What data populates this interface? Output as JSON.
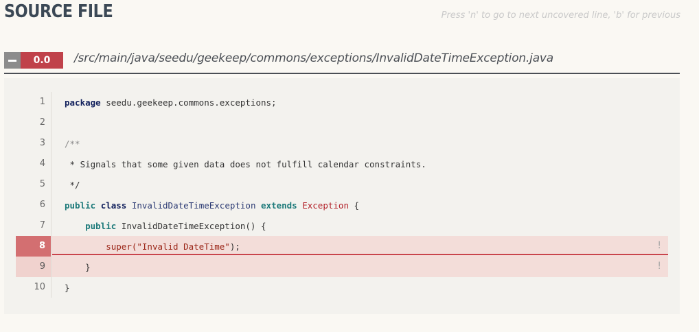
{
  "header": {
    "title": "SOURCE FILE",
    "hint": "Press 'n' to go to next uncovered line, 'b' for previous"
  },
  "file": {
    "coverage": "0.0",
    "path": "/src/main/java/seedu/geekeep/commons/exceptions/InvalidDateTimeException.java"
  },
  "lines": [
    {
      "n": "1"
    },
    {
      "n": "2"
    },
    {
      "n": "3"
    },
    {
      "n": "4"
    },
    {
      "n": "5"
    },
    {
      "n": "6"
    },
    {
      "n": "7"
    },
    {
      "n": "8"
    },
    {
      "n": "9"
    },
    {
      "n": "10"
    }
  ],
  "code": {
    "l1_kw": "package",
    "l1_rest": " seedu.geekeep.commons.exceptions;",
    "l3": "/**",
    "l4": " * Signals that some given data does not fulfill calendar constraints.",
    "l5": " */",
    "l6_public": "public",
    "l6_class": "class",
    "l6_name": "InvalidDateTimeException",
    "l6_extends": "extends",
    "l6_parent": "Exception",
    "l6_brace": " {",
    "l7_public": "public",
    "l7_rest": " InvalidDateTimeException() {",
    "l8_super": "super(",
    "l8_str": "\"Invalid DateTime\"",
    "l8_end": ");",
    "l9": "    }",
    "l10": "}"
  },
  "marks": {
    "uncovered": "!"
  },
  "colors": {
    "uncovered_line": "#c0424a",
    "uncovered_bg": "#f3ddd9"
  }
}
